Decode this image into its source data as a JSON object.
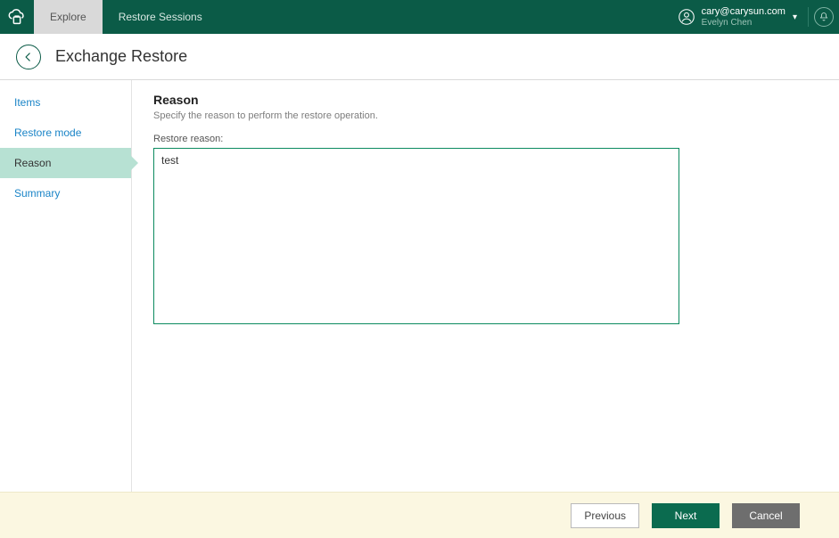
{
  "topbar": {
    "tabs": [
      {
        "label": "Explore",
        "active": true
      },
      {
        "label": "Restore Sessions",
        "active": false
      }
    ],
    "user_email": "cary@carysun.com",
    "user_name": "Evelyn Chen"
  },
  "header": {
    "title": "Exchange Restore"
  },
  "wizard": {
    "steps": [
      {
        "label": "Items",
        "active": false
      },
      {
        "label": "Restore mode",
        "active": false
      },
      {
        "label": "Reason",
        "active": true
      },
      {
        "label": "Summary",
        "active": false
      }
    ]
  },
  "main": {
    "section_title": "Reason",
    "section_sub": "Specify the reason to perform the restore operation.",
    "field_label": "Restore reason:",
    "reason_value": "test"
  },
  "footer": {
    "previous": "Previous",
    "next": "Next",
    "cancel": "Cancel"
  }
}
